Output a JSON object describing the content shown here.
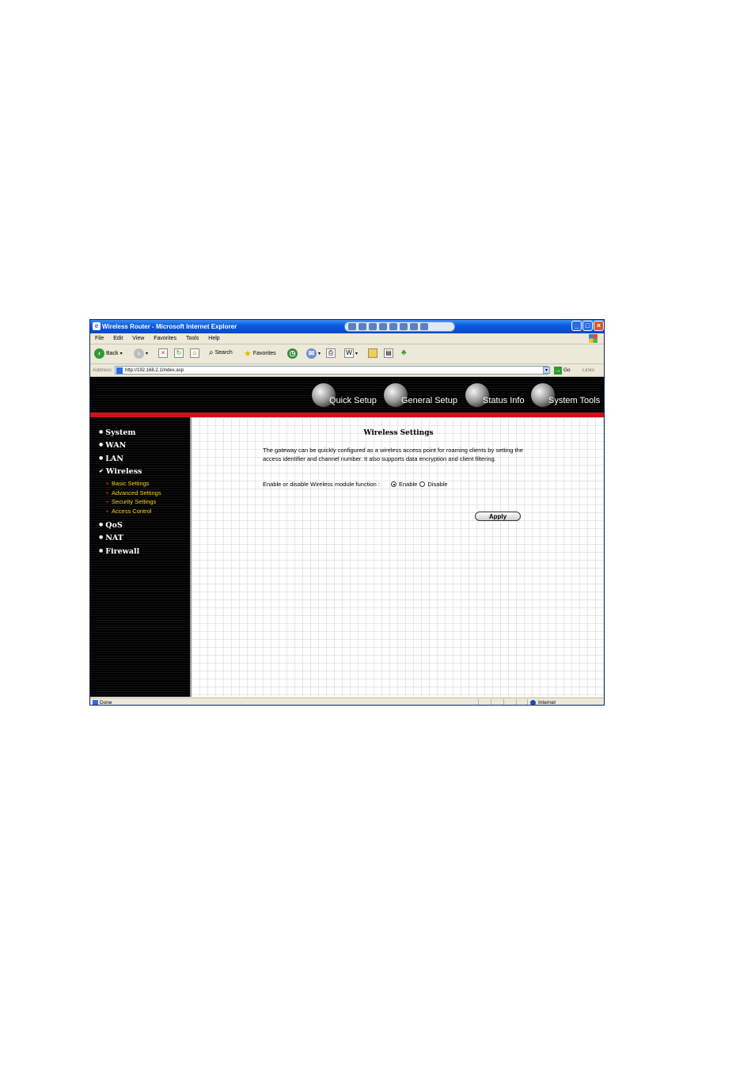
{
  "window": {
    "title": "Wireless Router - Microsoft Internet Explorer"
  },
  "menu": [
    "File",
    "Edit",
    "View",
    "Favorites",
    "Tools",
    "Help"
  ],
  "toolbar": {
    "back": "Back",
    "search": "Search",
    "favorites": "Favorites"
  },
  "address": {
    "label": "Address",
    "url": "http://192.168.2.1/index.asp",
    "go": "Go",
    "links": "Links"
  },
  "router_nav": [
    {
      "label": "Quick Setup"
    },
    {
      "label": "General Setup"
    },
    {
      "label": "Status Info"
    },
    {
      "label": "System Tools"
    }
  ],
  "sidebar": {
    "items": [
      "System",
      "WAN",
      "LAN",
      "Wireless",
      "QoS",
      "NAT",
      "Firewall"
    ],
    "wireless_sub": [
      "Basic Settings",
      "Advanced Settings",
      "Security Settings",
      "Access Control"
    ]
  },
  "main": {
    "title": "Wireless Settings",
    "description": "The gateway can be quickly configured as a wireless access point for roaming clients by setting the access identifier and channel number. It also supports data encryption and client filtering.",
    "function_label": "Enable or disable Wireless module function :",
    "enable_label": "Enable",
    "disable_label": "Disable",
    "selected": "Enable",
    "apply_label": "Apply"
  },
  "status": {
    "left": "Done",
    "zone": "Internet"
  }
}
